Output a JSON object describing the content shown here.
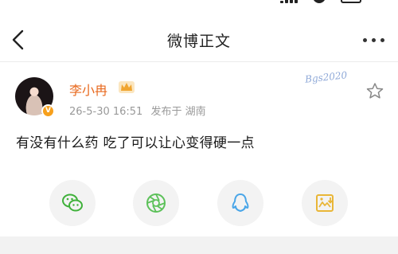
{
  "header": {
    "title": "微博正文"
  },
  "post": {
    "author": "李小冉",
    "time": "26-5-30 16:51",
    "posted_from": "发布于 湖南",
    "text": "有没有什么药 吃了可以让心变得硬一点",
    "watermark": "Bgs2020"
  },
  "share": [
    "wechat-icon",
    "moments-icon",
    "qq-icon",
    "save-image-icon"
  ],
  "colors": {
    "username": "#e8691e",
    "badge": "#f7a01c",
    "meta": "#999999"
  }
}
